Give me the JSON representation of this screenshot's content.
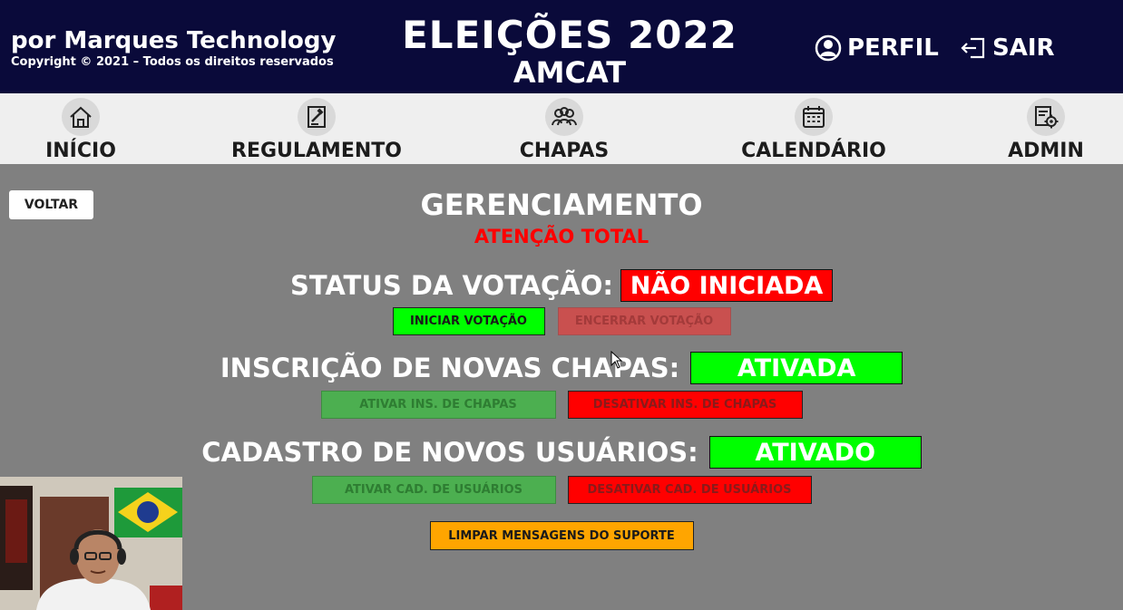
{
  "header": {
    "brand": "por Marques Technology",
    "copyright": "Copyright © 2021 – Todos os direitos reservados",
    "title": "ELEIÇÕES 2022",
    "subtitle": "AMCAT",
    "profile_label": "PERFIL",
    "logout_label": "SAIR",
    "profile_icon": "user-icon",
    "logout_icon": "logout-icon"
  },
  "nav": {
    "items": [
      {
        "label": "INÍCIO",
        "icon": "home-icon"
      },
      {
        "label": "REGULAMENTO",
        "icon": "gavel-document-icon"
      },
      {
        "label": "CHAPAS",
        "icon": "group-icon"
      },
      {
        "label": "CALENDÁRIO",
        "icon": "calendar-icon"
      },
      {
        "label": "ADMIN",
        "icon": "admin-settings-icon"
      }
    ]
  },
  "main": {
    "back_label": "VOLTAR",
    "title": "GERENCIAMENTO",
    "warning": "ATENÇÃO TOTAL",
    "voting": {
      "label": "STATUS DA VOTAÇÃO:",
      "status": "NÃO INICIADA",
      "start_label": "INICIAR VOTAÇÃO",
      "end_label": "ENCERRAR VOTAÇÃO"
    },
    "slates": {
      "label": "INSCRIÇÃO DE NOVAS CHAPAS:",
      "status": "ATIVADA",
      "enable_label": "ATIVAR INS. DE CHAPAS",
      "disable_label": "DESATIVAR INS. DE CHAPAS"
    },
    "users": {
      "label": "CADASTRO DE NOVOS USUÁRIOS:",
      "status": "ATIVADO",
      "enable_label": "ATIVAR CAD. DE USUÁRIOS",
      "disable_label": "DESATIVAR CAD. DE USUÁRIOS"
    },
    "clear_support_label": "LIMPAR MENSAGENS DO SUPORTE"
  },
  "colors": {
    "header_bg": "#0a0a3a",
    "page_bg": "#808080",
    "status_red": "#ff0000",
    "status_green": "#00ff00",
    "muted_green": "#4caf50",
    "orange": "#ffa500",
    "warning_text": "#ff0000"
  }
}
